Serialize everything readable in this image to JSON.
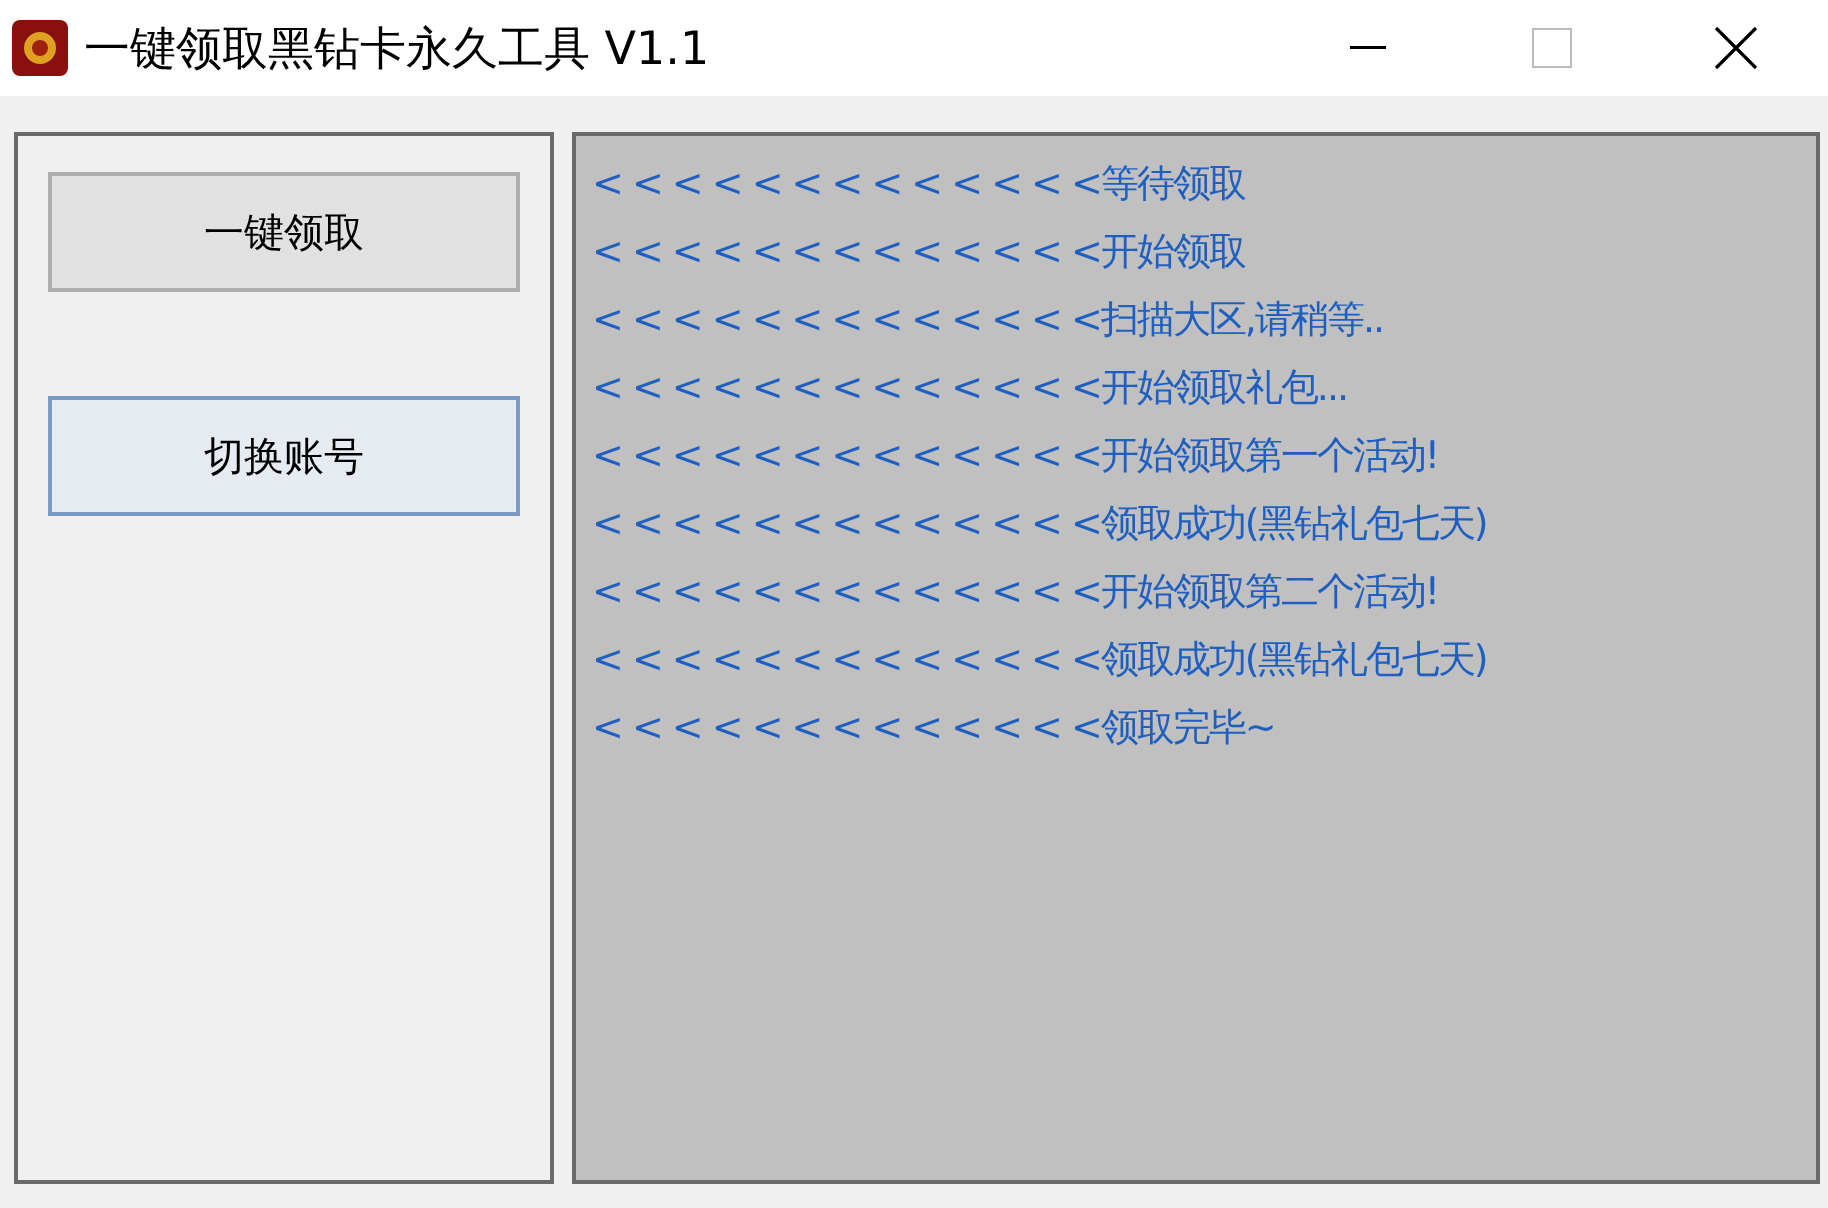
{
  "window": {
    "title": "一键领取黑钻卡永久工具 V1.1"
  },
  "buttons": [
    {
      "label": "一键领取",
      "focused": false
    },
    {
      "label": "切换账号",
      "focused": true
    }
  ],
  "log": [
    "< < < < < < < < < < < < <等待领取",
    "< < < < < < < < < < < < <开始领取",
    "< < < < < < < < < < < < <扫描大区,请稍等..",
    "< < < < < < < < < < < < <开始领取礼包...",
    "< < < < < < < < < < < < <开始领取第一个活动!",
    "< < < < < < < < < < < < <领取成功(黑钻礼包七天)",
    "< < < < < < < < < < < < <开始领取第二个活动!",
    "< < < < < < < < < < < < <领取成功(黑钻礼包七天)",
    "< < < < < < < < < < < < <领取完毕~"
  ]
}
